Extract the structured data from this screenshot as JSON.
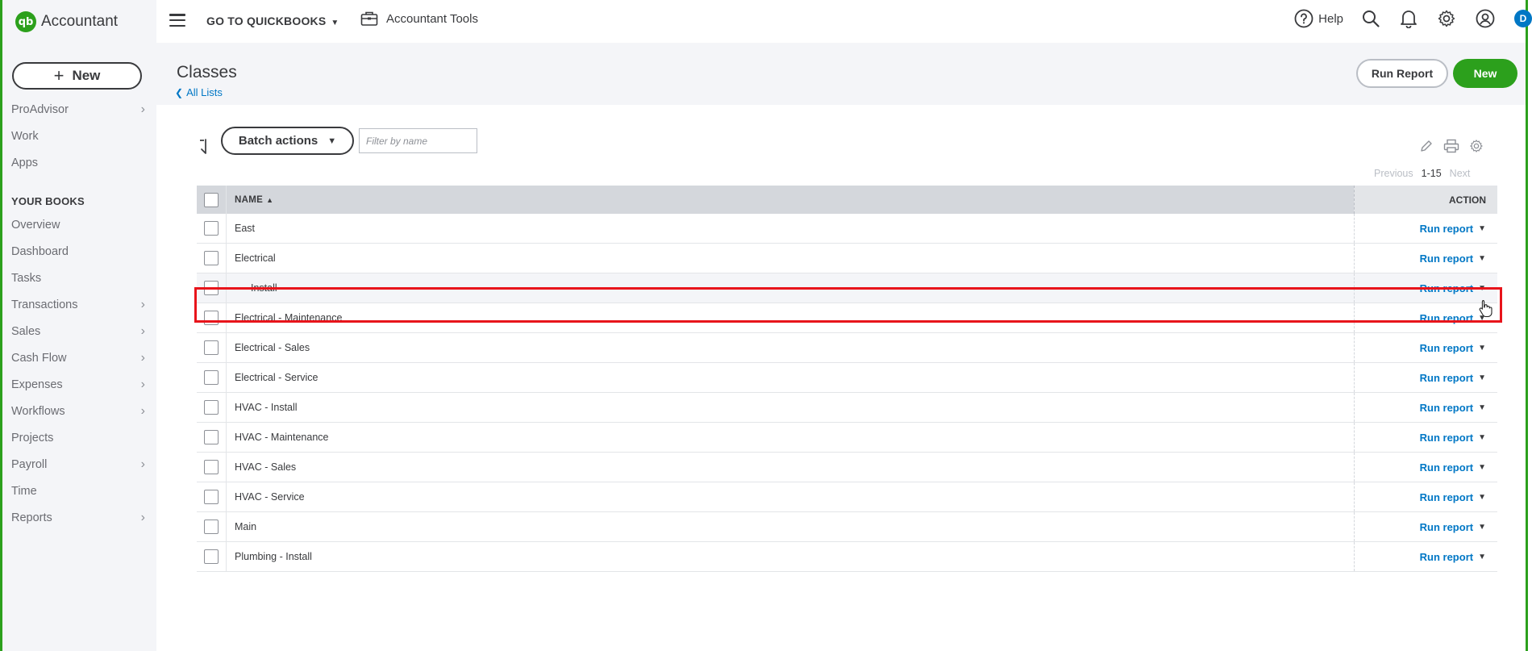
{
  "sidebar": {
    "brand": "Accountant",
    "brand_logo": "qb",
    "new_label": "New",
    "items_top": [
      {
        "label": "ProAdvisor",
        "chevron": true
      },
      {
        "label": "Work",
        "chevron": false
      },
      {
        "label": "Apps",
        "chevron": false
      }
    ],
    "section_title": "YOUR BOOKS",
    "items": [
      {
        "label": "Overview",
        "chevron": false
      },
      {
        "label": "Dashboard",
        "chevron": false
      },
      {
        "label": "Tasks",
        "chevron": false
      },
      {
        "label": "Transactions",
        "chevron": true
      },
      {
        "label": "Sales",
        "chevron": true
      },
      {
        "label": "Cash Flow",
        "chevron": true
      },
      {
        "label": "Expenses",
        "chevron": true
      },
      {
        "label": "Workflows",
        "chevron": true
      },
      {
        "label": "Projects",
        "chevron": false
      },
      {
        "label": "Payroll",
        "chevron": true
      },
      {
        "label": "Time",
        "chevron": false
      },
      {
        "label": "Reports",
        "chevron": true
      }
    ]
  },
  "topbar": {
    "goto": "GO TO QUICKBOOKS",
    "accountant_tools": "Accountant Tools",
    "help": "Help",
    "avatar_initial": "D"
  },
  "header": {
    "title": "Classes",
    "back_link": "All Lists",
    "run_report": "Run Report",
    "new": "New"
  },
  "toolbar": {
    "batch_actions": "Batch actions",
    "filter_placeholder": "Filter by name",
    "pager_prev": "Previous",
    "pager_range": "1-15",
    "pager_next": "Next"
  },
  "table": {
    "col_name": "NAME",
    "col_action": "ACTION",
    "action_label": "Run report",
    "rows": [
      {
        "name": "East",
        "sub": false
      },
      {
        "name": "Electrical",
        "sub": false
      },
      {
        "name": "Install",
        "sub": true
      },
      {
        "name": "Electrical - Maintenance",
        "sub": false
      },
      {
        "name": "Electrical - Sales",
        "sub": false
      },
      {
        "name": "Electrical - Service",
        "sub": false
      },
      {
        "name": "HVAC - Install",
        "sub": false
      },
      {
        "name": "HVAC - Maintenance",
        "sub": false
      },
      {
        "name": "HVAC - Sales",
        "sub": false
      },
      {
        "name": "HVAC - Service",
        "sub": false
      },
      {
        "name": "Main",
        "sub": false
      },
      {
        "name": "Plumbing - Install",
        "sub": false
      }
    ]
  },
  "colors": {
    "brand_green": "#2ca01c",
    "link_blue": "#0077c5",
    "highlight_red": "#e8141b"
  }
}
